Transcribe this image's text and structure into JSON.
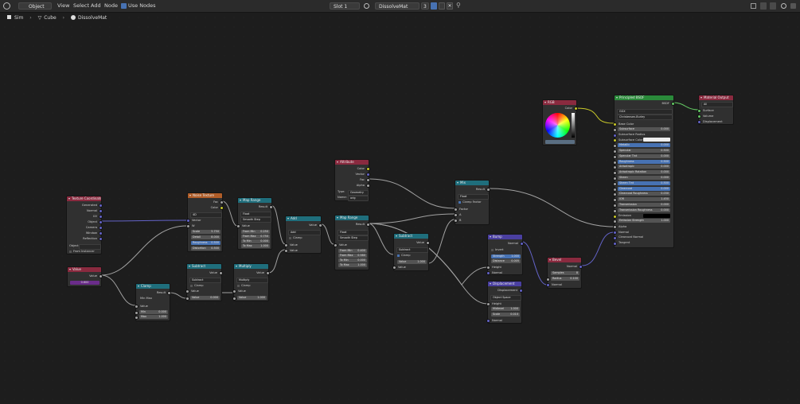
{
  "topbar": {
    "mode": "Object",
    "menus": [
      "View",
      "Select",
      "Add",
      "Node"
    ],
    "use_nodes": "Use Nodes",
    "slot": "Slot 1",
    "material": "DissolveMat",
    "users": "3"
  },
  "breadcrumb": {
    "items": [
      "Sim",
      "Cube",
      "DissolveMat"
    ]
  },
  "colors": {
    "geometry_header": "#1f6e7c",
    "input_header": "#8a2a3f",
    "texture_header": "#b05d28",
    "shader_header": "#2a8a3a",
    "vector_header": "#4a3fa0",
    "output_header": "#8a2a3f",
    "link_yellow": "#c7c729",
    "link_grey": "#a1a1a1",
    "link_purple": "#6363c7",
    "link_green": "#63c763"
  },
  "nodes": {
    "texcoord": {
      "title": "Texture Coordinate",
      "outputs": [
        "Generated",
        "Normal",
        "UV",
        "Object",
        "Camera",
        "Window",
        "Reflection"
      ],
      "object_label": "Object",
      "from_instancer": "From Instancer"
    },
    "value": {
      "title": "Value",
      "out": "Value",
      "val": "0.600"
    },
    "clamp": {
      "title": "Clamp",
      "out": "Result",
      "type": "Min Max",
      "input": "Value",
      "min_l": "Min",
      "min_v": "0.000",
      "max_l": "Max",
      "max_v": "1.000"
    },
    "noise": {
      "title": "Noise Texture",
      "out1": "Fac",
      "out2": "Color",
      "dim": "4D",
      "in_vector": "Vector",
      "in_w": "W",
      "scale_l": "Scale",
      "scale_v": "5.750",
      "detail_l": "Detail",
      "detail_v": "8.000",
      "rough_l": "Roughness",
      "rough_v": "0.500",
      "dist_l": "Distortion",
      "dist_v": "0.500"
    },
    "maprange1": {
      "title": "Map Range",
      "out": "Result",
      "dtype": "Float",
      "interp": "Smooth Step",
      "in": "Value",
      "f_min_l": "From Min",
      "f_min_v": "0.250",
      "f_max_l": "From Max",
      "f_max_v": "0.750",
      "t_min_l": "To Min",
      "t_min_v": "0.000",
      "t_max_l": "To Max",
      "t_max_v": "1.000"
    },
    "subtract1": {
      "title": "Subtract",
      "out": "Value",
      "op": "Subtract",
      "clamp": "Clamp",
      "in": "Value",
      "val_l": "Value",
      "val_v": "0.000"
    },
    "multiply": {
      "title": "Multiply",
      "out": "Value",
      "op": "Multiply",
      "clamp": "Clamp",
      "in": "Value",
      "val_l": "Value",
      "val_v": "1.000"
    },
    "add": {
      "title": "Add",
      "out": "Value",
      "op": "Add",
      "clamp": "Clamp",
      "in1": "Value",
      "in2": "Value"
    },
    "attribute": {
      "title": "Attribute",
      "outs": [
        "Color",
        "Vector",
        "Fac",
        "Alpha"
      ],
      "type_l": "Type:",
      "type_v": "Geometry",
      "name_l": "Name:",
      "name_v": "orig"
    },
    "maprange2": {
      "title": "Map Range",
      "out": "Result",
      "dtype": "Float",
      "interp": "Smooth Step",
      "in": "Value",
      "f_min_l": "From Min",
      "f_min_v": "0.400",
      "f_max_l": "From Max",
      "f_max_v": "0.580",
      "t_min_l": "To Min",
      "t_min_v": "0.000",
      "t_max_l": "To Max",
      "t_max_v": "1.000"
    },
    "subtract2": {
      "title": "Subtract",
      "out": "Value",
      "op": "Subtract",
      "clamp": "Clamp",
      "val_l": "Value",
      "val_v": "1.000",
      "in": "Value"
    },
    "mix": {
      "title": "Mix",
      "out": "Result",
      "dtype": "Float",
      "clamp_factor": "Clamp Factor",
      "factor": "Factor",
      "a": "A",
      "b": "B"
    },
    "bump": {
      "title": "Bump",
      "out": "Normal",
      "invert": "Invert",
      "str_l": "Strength",
      "str_v": "1.000",
      "dist_l": "Distance",
      "dist_v": "0.005",
      "height": "Height",
      "normal": "Normal"
    },
    "displacement": {
      "title": "Displacement",
      "out": "Displacement",
      "space": "Object Space",
      "height": "Height",
      "mid_l": "Midlevel",
      "mid_v": "1.000",
      "scale_l": "Scale",
      "scale_v": "0.010",
      "normal": "Normal"
    },
    "bevel": {
      "title": "Bevel",
      "out": "Normal",
      "samples_l": "Samples",
      "samples_v": "8",
      "radius_l": "Radius",
      "radius_v": "0.100",
      "normal": "Normal"
    },
    "rgb": {
      "title": "RGB",
      "out": "Color"
    },
    "bsdf": {
      "title": "Principled BSDF",
      "out": "BSDF",
      "dist": "GGX",
      "sss": "Christensen-Burley",
      "rows": [
        {
          "l": "Base Color",
          "v": ""
        },
        {
          "l": "Subsurface",
          "v": "0.000"
        },
        {
          "l": "Subsurface Radius",
          "v": ""
        },
        {
          "l": "Subsurface Color",
          "v": ""
        },
        {
          "l": "Metallic",
          "v": "0.000"
        },
        {
          "l": "Specular",
          "v": "0.500"
        },
        {
          "l": "Specular Tint",
          "v": "0.000"
        },
        {
          "l": "Roughness",
          "v": "0.500"
        },
        {
          "l": "Anisotropic",
          "v": "0.000"
        },
        {
          "l": "Anisotropic Rotation",
          "v": "0.000"
        },
        {
          "l": "Sheen",
          "v": "0.000"
        },
        {
          "l": "Sheen Tint",
          "v": "0.500"
        },
        {
          "l": "Clearcoat",
          "v": "0.000"
        },
        {
          "l": "Clearcoat Roughness",
          "v": "0.030"
        },
        {
          "l": "IOR",
          "v": "1.450"
        },
        {
          "l": "Transmission",
          "v": "0.000"
        },
        {
          "l": "Transmission Roughness",
          "v": "0.000"
        },
        {
          "l": "Emission",
          "v": ""
        },
        {
          "l": "Emission Strength",
          "v": "1.000"
        },
        {
          "l": "Alpha",
          "v": ""
        },
        {
          "l": "Normal",
          "v": ""
        },
        {
          "l": "Clearcoat Normal",
          "v": ""
        },
        {
          "l": "Tangent",
          "v": ""
        }
      ]
    },
    "output": {
      "title": "Material Output",
      "target": "All",
      "ins": [
        "Surface",
        "Volume",
        "Displacement"
      ]
    }
  }
}
